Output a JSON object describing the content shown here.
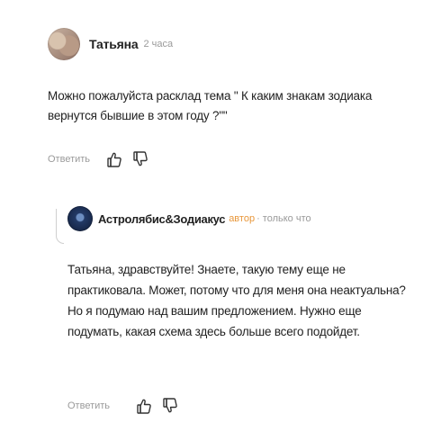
{
  "comment": {
    "author": "Татьяна",
    "time": "2 часа",
    "text": "Можно пожалуйста расклад тема \" К каким знакам зодиака вернутся бывшие в этом году ?\"\"",
    "reply_label": "Ответить"
  },
  "reply": {
    "author": "Астролябис&Зодиакус",
    "badge": "автор",
    "time": " · только что",
    "text": "Татьяна, здравствуйте! Знаете, такую тему еще не практиковала. Может, потому что для меня она неактуальна? Но я подумаю над вашим предложением. Нужно еще подумать, какая схема здесь больше всего подойдет.",
    "reply_label": "Ответить"
  },
  "icons": {
    "like": "thumbs-up-icon",
    "dislike": "thumbs-down-icon"
  },
  "colors": {
    "badge": "#e8973b",
    "muted": "#9a9a9a"
  }
}
